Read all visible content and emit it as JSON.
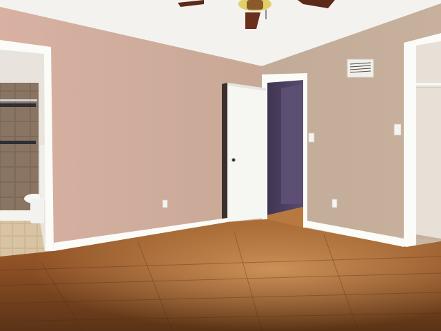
{
  "scene": {
    "description_free": true,
    "colors": {
      "ceiling": "#f3f2ef",
      "wall_left": "#cfab9d",
      "wall_right": "#c3ac97",
      "floor_dark": "#5a3316",
      "floor_mid": "#8a5127",
      "floor_light": "#b7793f",
      "trim": "#fbfbf8",
      "door": "#f6f6f3",
      "hall_wall": "#4b3f5e",
      "tile": "#7a6756",
      "fan_blade": "#6a2f1d",
      "fan_light": "#e8d56a"
    },
    "objects": [
      "ceiling-fan",
      "bathroom-doorway",
      "interior-door",
      "hallway-opening",
      "closet-doorway",
      "air-vent",
      "light-switch",
      "power-outlet"
    ]
  }
}
